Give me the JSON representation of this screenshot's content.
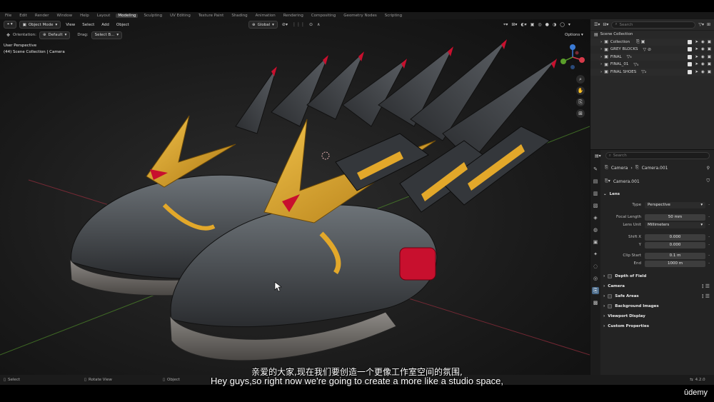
{
  "workspace_tabs": [
    "File",
    "Edit",
    "Render",
    "Window",
    "Help",
    "Layout",
    "Modeling",
    "Sculpting",
    "UV Editing",
    "Texture Paint",
    "Shading",
    "Animation",
    "Rendering",
    "Compositing",
    "Geometry Nodes",
    "Scripting"
  ],
  "active_workspace": "Modeling",
  "viewport": {
    "mode": "Object Mode",
    "menus": [
      "View",
      "Select",
      "Add",
      "Object"
    ],
    "orientation_label": "Orientation:",
    "orientation_value": "Default",
    "drag_label": "Drag:",
    "drag_value": "Select B...",
    "transform": "Global",
    "options": "Options",
    "overlay_line1": "User Perspective",
    "overlay_line2": "(44) Scene Collection | Camera"
  },
  "outliner": {
    "search_placeholder": "Search",
    "root": "Scene Collection",
    "items": [
      {
        "label": "Collection"
      },
      {
        "label": "GREY BLOCKS"
      },
      {
        "label": "FINAL"
      },
      {
        "label": "FINAL_01"
      },
      {
        "label": "FINAL SHOES"
      }
    ]
  },
  "properties": {
    "search_placeholder": "Search",
    "breadcrumb_1": "Camera",
    "breadcrumb_2": "Camera.001",
    "datablock": "Camera.001",
    "lens_section": "Lens",
    "type_label": "Type",
    "type_value": "Perspective",
    "focal_label": "Focal Length",
    "focal_value": "50 mm",
    "lens_unit_label": "Lens Unit",
    "lens_unit_value": "Millimeters",
    "shift_x_label": "Shift X",
    "shift_x_value": "0.000",
    "shift_y_label": "Y",
    "shift_y_value": "0.000",
    "clip_start_label": "Clip Start",
    "clip_start_value": "0.1 m",
    "clip_end_label": "End",
    "clip_end_value": "1000 m",
    "sections": [
      "Depth of Field",
      "Camera",
      "Safe Areas",
      "Background Images",
      "Viewport Display",
      "Custom Properties"
    ]
  },
  "statusbar": {
    "select": "Select",
    "rotate": "Rotate View",
    "object": "Object",
    "version": "4.2.0"
  },
  "subtitles": {
    "chinese": "亲爱的大家,现在我们要创造一个更像工作室空间的氛围,",
    "english": "Hey guys,so right now we're going to create a more like a studio space,"
  },
  "brand": "ûdemy",
  "colors": {
    "accent_yellow": "#e3a82a",
    "accent_red": "#d2122e",
    "blender_blue": "#4a6a8a"
  }
}
